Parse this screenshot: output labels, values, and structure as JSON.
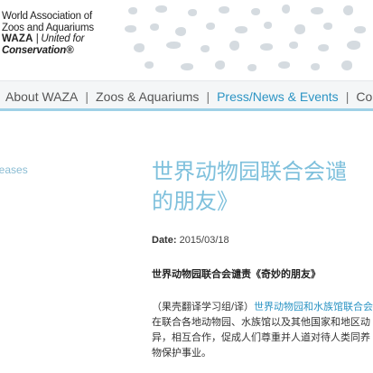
{
  "logo": {
    "line1": "World Association of",
    "line2": "Zoos and Aquariums",
    "line3_bold": "WAZA",
    "line3_rest": " | United for",
    "line4": "Conservation®"
  },
  "nav": {
    "items": [
      {
        "label": "About WAZA"
      },
      {
        "label": "Zoos & Aquariums"
      },
      {
        "label": "Press/News & Events"
      },
      {
        "label": "Cons"
      }
    ],
    "separator": "|"
  },
  "sidebar": {
    "link": "leases"
  },
  "article": {
    "title_line1": "世界动物园联合会谴",
    "title_line2": "的朋友》",
    "date_label": "Date:",
    "date_value": "2015/03/18",
    "subhead": "世界动物园联合会谴责《奇妙的朋友》",
    "para_prefix": "（果壳翻译学习组/译）",
    "para_link": "世界动物园和水族馆联合会",
    "para_line2": "在联合各地动物园、水族馆以及其他国家和地区动",
    "para_line3": "异，相互合作，促成人们尊重并人道对待人类同养",
    "para_line4": "物保护事业。"
  }
}
